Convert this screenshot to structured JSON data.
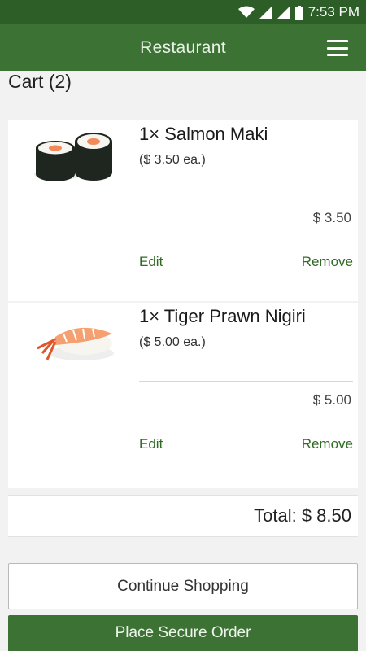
{
  "status_bar": {
    "time": "7:53 PM"
  },
  "app_bar": {
    "title": "Restaurant"
  },
  "cart": {
    "heading": "Cart (2)",
    "items": [
      {
        "name": "1× Salmon Maki",
        "unit_price": "($ 3.50 ea.)",
        "subtotal": "$ 3.50",
        "edit_label": "Edit",
        "remove_label": "Remove",
        "image": "salmon-maki"
      },
      {
        "name": "1× Tiger Prawn Nigiri",
        "unit_price": "($ 5.00 ea.)",
        "subtotal": "$ 5.00",
        "edit_label": "Edit",
        "remove_label": "Remove",
        "image": "tiger-prawn-nigiri"
      }
    ],
    "total": "Total: $ 8.50"
  },
  "actions": {
    "continue_label": "Continue Shopping",
    "order_label": "Place Secure Order"
  },
  "colors": {
    "primary": "#3c7234",
    "status_bar": "#2d5e28",
    "link": "#2f6b24"
  }
}
